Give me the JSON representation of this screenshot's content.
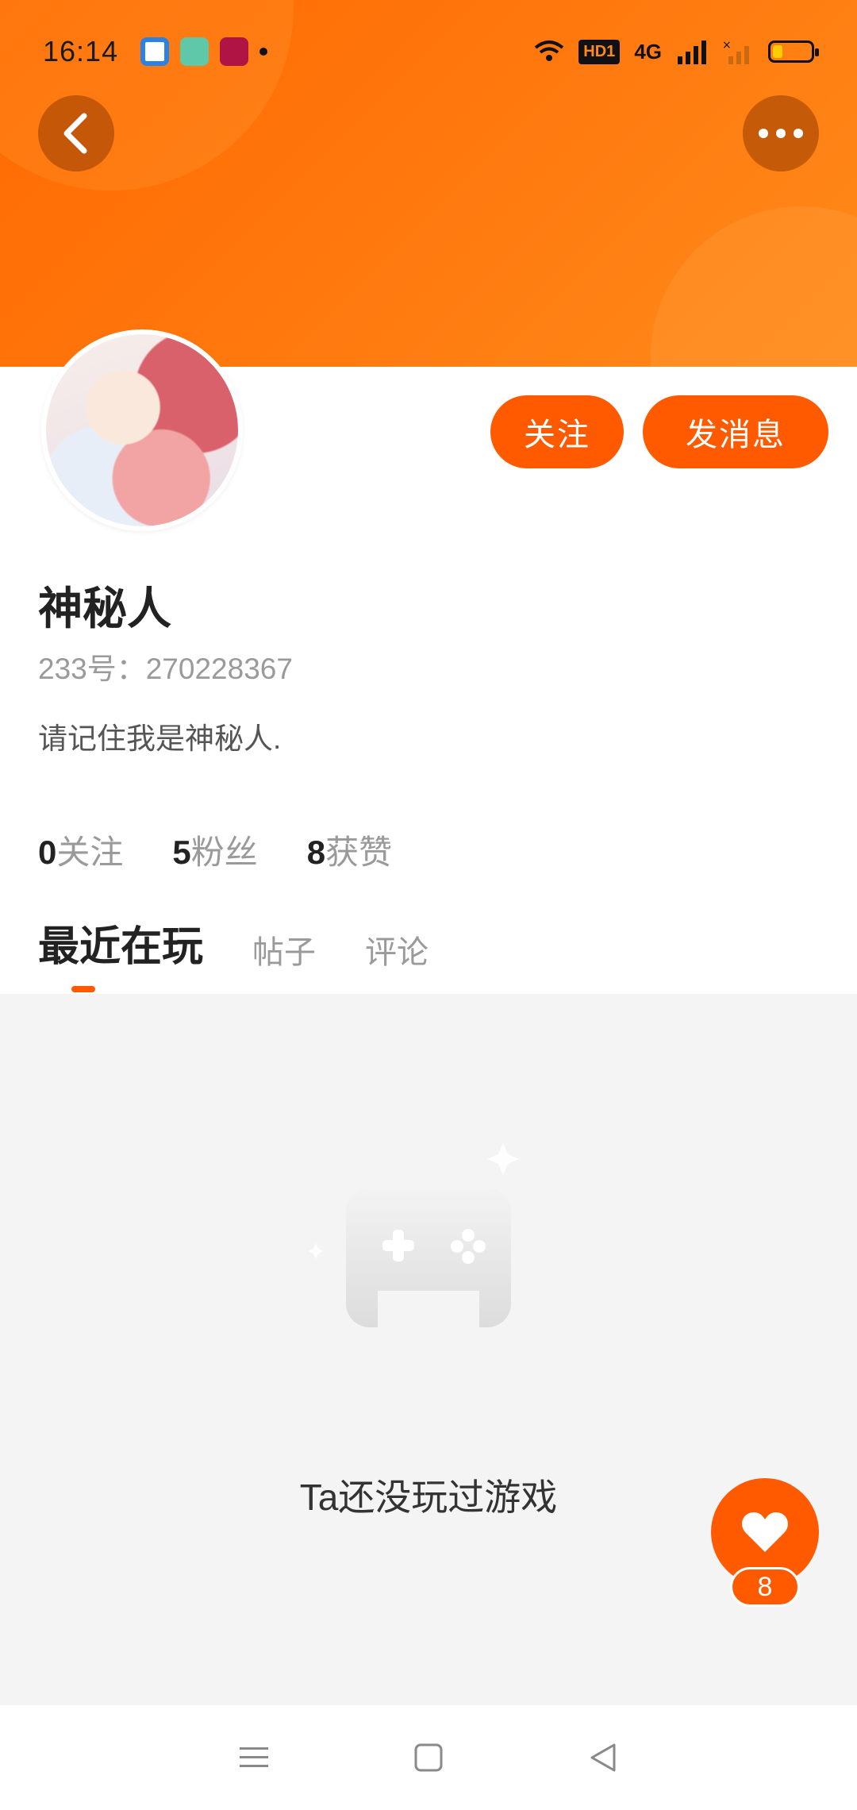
{
  "status_bar": {
    "time": "16:14",
    "hd_label": "HD1",
    "network_label": "4G"
  },
  "profile": {
    "name": "神秘人",
    "id_line": "233号：270228367",
    "bio": "请记住我是神秘人.",
    "follow_button": "关注",
    "message_button": "发消息"
  },
  "stats": [
    {
      "value": "0",
      "label": "关注"
    },
    {
      "value": "5",
      "label": "粉丝"
    },
    {
      "value": "8",
      "label": "获赞"
    }
  ],
  "tabs": [
    {
      "label": "最近在玩",
      "active": true
    },
    {
      "label": "帖子",
      "active": false
    },
    {
      "label": "评论",
      "active": false
    }
  ],
  "empty_state": {
    "text": "Ta还没玩过游戏",
    "icon": "gamepad-icon"
  },
  "like": {
    "count": "8",
    "icon": "heart-icon"
  },
  "colors": {
    "accent": "#ff5a00",
    "banner": "#ff7a10",
    "muted_text": "#9a9a9a",
    "content_bg": "#f4f4f4"
  }
}
